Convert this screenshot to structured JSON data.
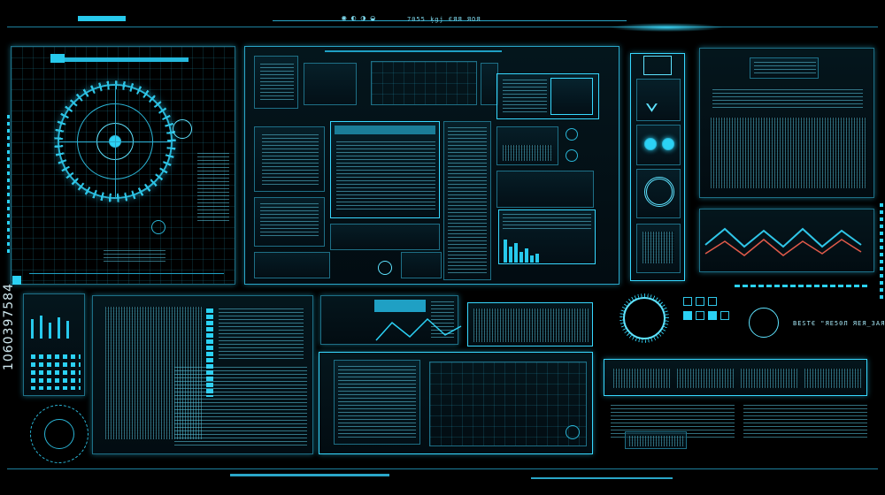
{
  "header": {
    "status_text": "7055   ķgj  ЄЯЯ ЯОЯ"
  },
  "watermark": {
    "stock_id": "1060397584"
  },
  "status_panel": {
    "readout": "ВЕЅТЄ \"ЯЕ50Л ЯЕЯ_ЗАЯ\" ЇЕЯ_"
  },
  "theme": {
    "accent": "#2bd2f5",
    "line": "#1e6f86",
    "background": "#000000",
    "highlight": "#37d8ff",
    "wave_cyan": "#2fc6e8",
    "wave_red": "#e05a4a"
  },
  "icons": {
    "radar": "radar-dial-icon",
    "chevron": "chevron-down-icon",
    "fingerprint": "fingerprint-icon",
    "target": "crosshair-icon"
  }
}
